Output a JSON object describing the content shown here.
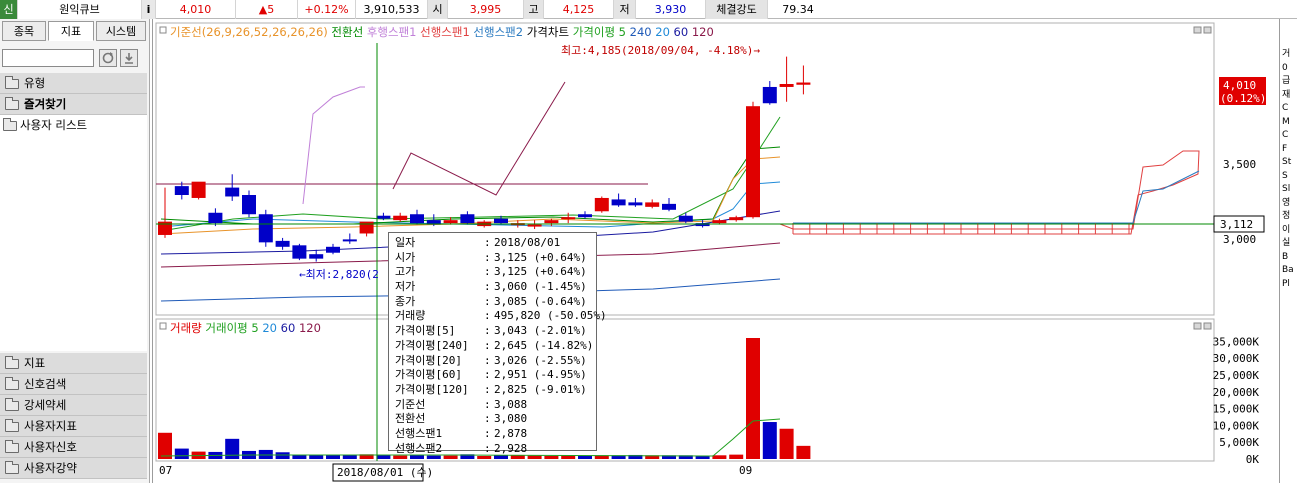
{
  "topbar": {
    "tag": "신",
    "name": "원익큐브",
    "info": "i",
    "price": "4,010",
    "change": "▲5",
    "change_pct": "+0.12%",
    "volume": "3,910,533",
    "open_label": "시",
    "open": "3,995",
    "high_label": "고",
    "high": "4,125",
    "low_label": "저",
    "low": "3,930",
    "strength_label": "체결강도",
    "strength": "79.34"
  },
  "left_panel": {
    "tabs": [
      "종목",
      "지표",
      "시스템"
    ],
    "active_tab": "지표",
    "top_items": [
      {
        "label": "유형"
      },
      {
        "label": "즐겨찾기"
      },
      {
        "label": "사용자 리스트"
      }
    ],
    "bottom_items": [
      {
        "label": "지표"
      },
      {
        "label": "신호검색"
      },
      {
        "label": "강세약세"
      },
      {
        "label": "사용자지표"
      },
      {
        "label": "사용자신호"
      },
      {
        "label": "사용자강약"
      }
    ]
  },
  "chart": {
    "legend_parts": [
      {
        "text": "기준선(26,9,26,52,26,26,26)",
        "color": "#e8932a"
      },
      {
        "text": "전환선",
        "color": "#008a00"
      },
      {
        "text": "후행스팬1",
        "color": "#c080d8"
      },
      {
        "text": "선행스팬1",
        "color": "#e04040"
      },
      {
        "text": "선행스팬2",
        "color": "#2a7ac0"
      },
      {
        "text": "가격차트",
        "color": "#000000"
      },
      {
        "text": "가격이평 5",
        "color": "#20a020"
      },
      {
        "text": "240",
        "color": "#1f5ab8"
      },
      {
        "text": "20",
        "color": "#1f8ad8"
      },
      {
        "text": "60",
        "color": "#1a1aa0"
      },
      {
        "text": "120",
        "color": "#8a1a4a"
      }
    ],
    "high_annotation": "최고:4,185(2018/09/04, -4.18%)→",
    "low_annotation": "←최저:2,820(2",
    "price_tag": "4,010",
    "price_tag_pct": "(0.12%)",
    "crosshair_value": "3,112",
    "y_ticks": [
      "3,500",
      "3,000"
    ],
    "volume_legend_parts": [
      {
        "text": "거래량",
        "color": "#e00000"
      },
      {
        "text": "거래이평 5",
        "color": "#20a020"
      },
      {
        "text": "20",
        "color": "#1f8ad8"
      },
      {
        "text": "60",
        "color": "#1a1aa0"
      },
      {
        "text": "120",
        "color": "#8a1a4a"
      }
    ],
    "volume_ticks": [
      "35,000K",
      "30,000K",
      "25,000K",
      "20,000K",
      "15,000K",
      "10,000K",
      "5,000K",
      "0K"
    ],
    "x_labels": [
      "07",
      "09"
    ],
    "cursor_date": "2018/08/01 (수)",
    "colors": {
      "up": "#e00000",
      "down": "#0000c8",
      "crosshair": "#008a00"
    }
  },
  "chart_data": {
    "type": "candlestick",
    "candles": [
      {
        "o": 2980,
        "h": 3300,
        "c": 3070,
        "l": 2960
      },
      {
        "o": 3310,
        "h": 3340,
        "c": 3250,
        "l": 3220
      },
      {
        "o": 3230,
        "h": 3250,
        "c": 3340,
        "l": 3220
      },
      {
        "o": 3130,
        "h": 3160,
        "c": 3060,
        "l": 3040
      },
      {
        "o": 3300,
        "h": 3390,
        "c": 3240,
        "l": 3210
      },
      {
        "o": 3250,
        "h": 3280,
        "c": 3120,
        "l": 3100
      },
      {
        "o": 3120,
        "h": 3150,
        "c": 2930,
        "l": 2900
      },
      {
        "o": 2940,
        "h": 2960,
        "c": 2900,
        "l": 2880
      },
      {
        "o": 2910,
        "h": 2920,
        "c": 2820,
        "l": 2810
      },
      {
        "o": 2850,
        "h": 2880,
        "c": 2820,
        "l": 2800
      },
      {
        "o": 2900,
        "h": 2920,
        "c": 2860,
        "l": 2850
      },
      {
        "o": 2950,
        "h": 2990,
        "c": 2940,
        "l": 2920
      },
      {
        "o": 2990,
        "h": 3020,
        "c": 3070,
        "l": 2970
      },
      {
        "o": 3110,
        "h": 3130,
        "c": 3090,
        "l": 3080
      },
      {
        "o": 3080,
        "h": 3130,
        "c": 3110,
        "l": 3070
      },
      {
        "o": 3120,
        "h": 3150,
        "c": 3060,
        "l": 3050
      },
      {
        "o": 3080,
        "h": 3120,
        "c": 3050,
        "l": 3040
      },
      {
        "o": 3060,
        "h": 3100,
        "c": 3080,
        "l": 3050
      },
      {
        "o": 3120,
        "h": 3140,
        "c": 3060,
        "l": 3050
      },
      {
        "o": 3040,
        "h": 3080,
        "c": 3070,
        "l": 3030
      },
      {
        "o": 3090,
        "h": 3110,
        "c": 3060,
        "l": 3050
      },
      {
        "o": 3050,
        "h": 3080,
        "c": 3060,
        "l": 3030
      },
      {
        "o": 3040,
        "h": 3080,
        "c": 3050,
        "l": 3020
      },
      {
        "o": 3060,
        "h": 3090,
        "c": 3080,
        "l": 3040
      },
      {
        "o": 3090,
        "h": 3130,
        "c": 3100,
        "l": 3060
      },
      {
        "o": 3120,
        "h": 3140,
        "c": 3100,
        "l": 3090
      },
      {
        "o": 3140,
        "h": 3240,
        "c": 3230,
        "l": 3130
      },
      {
        "o": 3220,
        "h": 3260,
        "c": 3180,
        "l": 3170
      },
      {
        "o": 3200,
        "h": 3230,
        "c": 3180,
        "l": 3170
      },
      {
        "o": 3170,
        "h": 3220,
        "c": 3200,
        "l": 3160
      },
      {
        "o": 3190,
        "h": 3230,
        "c": 3150,
        "l": 3140
      },
      {
        "o": 3110,
        "h": 3130,
        "c": 3070,
        "l": 3060
      },
      {
        "o": 3060,
        "h": 3080,
        "c": 3040,
        "l": 3030
      },
      {
        "o": 3060,
        "h": 3090,
        "c": 3080,
        "l": 3050
      },
      {
        "o": 3080,
        "h": 3110,
        "c": 3100,
        "l": 3070
      },
      {
        "o": 3100,
        "h": 3880,
        "c": 3850,
        "l": 3090
      },
      {
        "o": 3980,
        "h": 4020,
        "c": 3870,
        "l": 3860
      },
      {
        "o": 3980,
        "h": 4185,
        "c": 4000,
        "l": 3880
      },
      {
        "o": 3995,
        "h": 4125,
        "c": 4010,
        "l": 3930
      }
    ],
    "volumes_k": [
      7800,
      3100,
      2200,
      2100,
      6000,
      2400,
      2700,
      2000,
      1200,
      1100,
      1100,
      1100,
      1400,
      1200,
      1000,
      1100,
      1000,
      1000,
      1400,
      900,
      1100,
      1200,
      1000,
      900,
      1000,
      1000,
      1100,
      1100,
      1200,
      1100,
      1100,
      1100,
      1000,
      1100,
      1300,
      36000,
      11000,
      9000,
      3910
    ],
    "tooltip": [
      {
        "k": "일자",
        "v": "2018/08/01"
      },
      {
        "k": "시가",
        "v": "3,125 (+0.64%)"
      },
      {
        "k": "고가",
        "v": "3,125 (+0.64%)"
      },
      {
        "k": "저가",
        "v": "3,060 (-1.45%)"
      },
      {
        "k": "종가",
        "v": "3,085 (-0.64%)"
      },
      {
        "k": "거래량",
        "v": "495,820 (-50.05%)"
      },
      {
        "k": "가격이평[5]",
        "v": "3,043 (-2.01%)"
      },
      {
        "k": "가격이평[240]",
        "v": "2,645 (-14.82%)"
      },
      {
        "k": "가격이평[20]",
        "v": "3,026 (-2.55%)"
      },
      {
        "k": "가격이평[60]",
        "v": "2,951 (-4.95%)"
      },
      {
        "k": "가격이평[120]",
        "v": "2,825 (-9.01%)"
      },
      {
        "k": "기준선",
        "v": "3,088"
      },
      {
        "k": "전환선",
        "v": "3,080"
      },
      {
        "k": "선행스팬1",
        "v": "2,878"
      },
      {
        "k": "선행스팬2",
        "v": "2,928"
      }
    ]
  },
  "right_strip": [
    "거",
    "0",
    "급",
    "재",
    "C",
    "M",
    "C",
    "F",
    "St",
    "S",
    "Sl",
    "영",
    "정",
    "이",
    "실",
    "B",
    "Ba",
    "Pl"
  ]
}
